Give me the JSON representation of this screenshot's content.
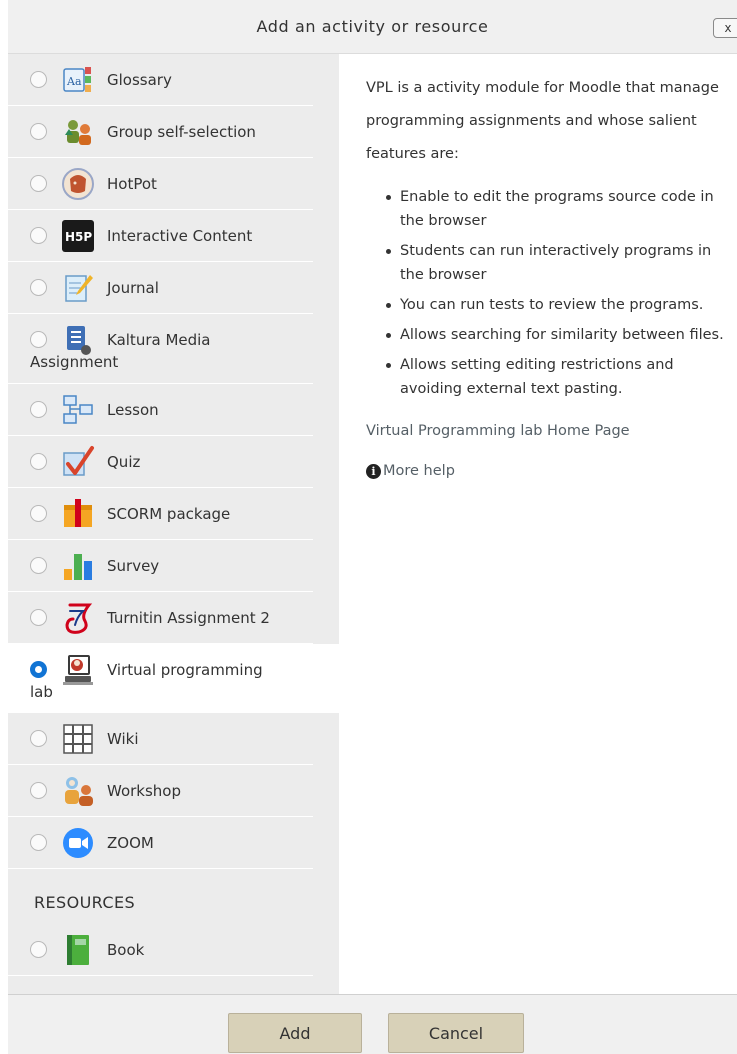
{
  "dialog": {
    "title": "Add an activity or resource",
    "close_label": "x"
  },
  "activities": [
    {
      "label": "Glossary",
      "icon": "glossary-icon",
      "selected": false
    },
    {
      "label": "Group self-selection",
      "icon": "group-self-selection-icon",
      "selected": false
    },
    {
      "label": "HotPot",
      "icon": "hotpot-icon",
      "selected": false
    },
    {
      "label": "Interactive Content",
      "icon": "h5p-icon",
      "selected": false
    },
    {
      "label": "Journal",
      "icon": "journal-icon",
      "selected": false
    },
    {
      "label": "Kaltura Media",
      "label_wrap": "Assignment",
      "icon": "kaltura-icon",
      "selected": false
    },
    {
      "label": "Lesson",
      "icon": "lesson-icon",
      "selected": false
    },
    {
      "label": "Quiz",
      "icon": "quiz-icon",
      "selected": false
    },
    {
      "label": "SCORM package",
      "icon": "scorm-icon",
      "selected": false
    },
    {
      "label": "Survey",
      "icon": "survey-icon",
      "selected": false
    },
    {
      "label": "Turnitin Assignment 2",
      "icon": "turnitin-icon",
      "selected": false
    },
    {
      "label": "Virtual programming",
      "label_wrap": "lab",
      "icon": "vpl-icon",
      "selected": true
    },
    {
      "label": "Wiki",
      "icon": "wiki-icon",
      "selected": false
    },
    {
      "label": "Workshop",
      "icon": "workshop-icon",
      "selected": false
    },
    {
      "label": "ZOOM",
      "icon": "zoom-icon",
      "selected": false
    }
  ],
  "resources_heading": "RESOURCES",
  "resources": [
    {
      "label": "Book",
      "icon": "book-icon",
      "selected": false
    }
  ],
  "help": {
    "intro": "VPL is a activity module for Moodle that manage programming assignments and whose salient features are:",
    "features": [
      "Enable to edit the programs source code in the browser",
      "Students can run interactively programs in the browser",
      "You can run tests to review the programs.",
      "Allows searching for similarity between files.",
      "Allows setting editing restrictions and avoiding external text pasting."
    ],
    "home_link": "Virtual Programming lab Home Page",
    "more_help": "More help"
  },
  "footer": {
    "add_label": "Add",
    "cancel_label": "Cancel"
  },
  "colors": {
    "accent": "#1174d4",
    "button_bg": "#d8d1b8",
    "panel_bg": "#ececec"
  }
}
